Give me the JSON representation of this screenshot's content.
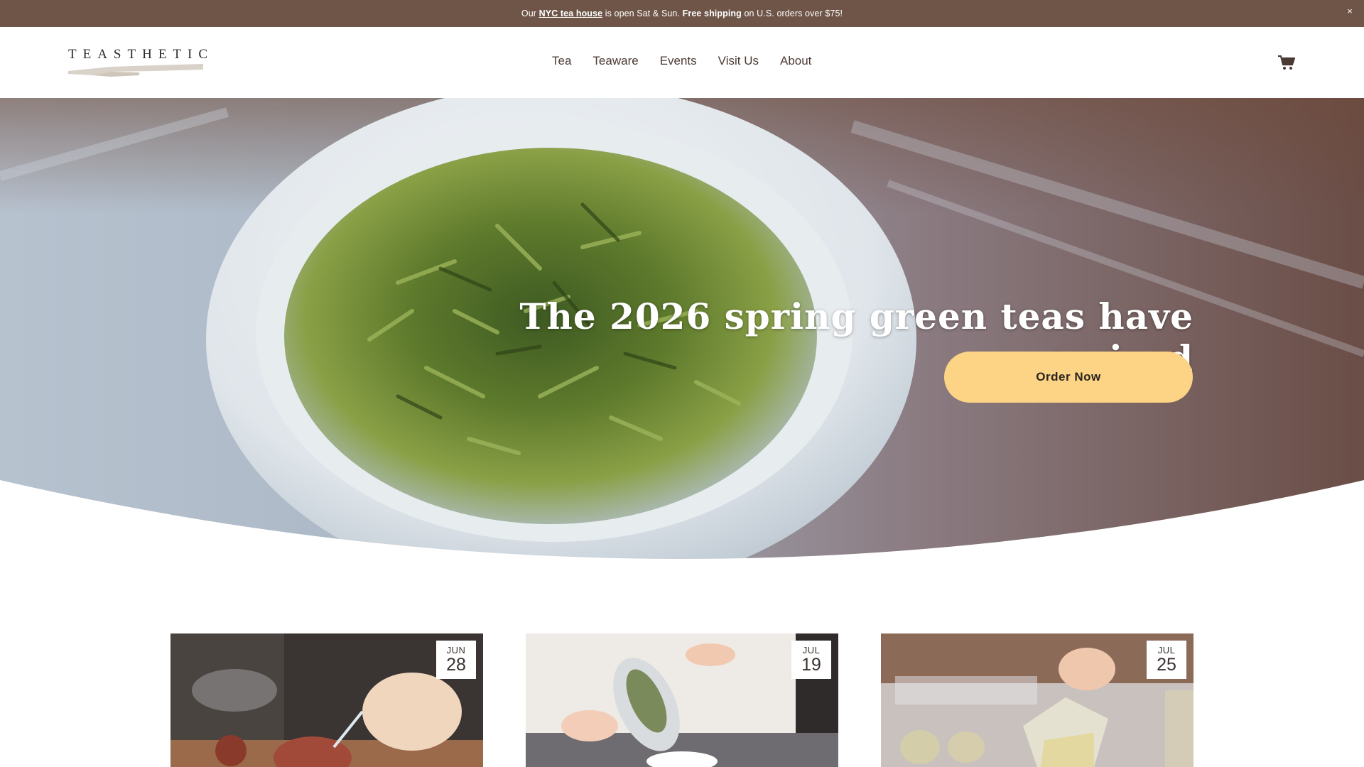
{
  "announcement": {
    "prefix": "Our",
    "link_text": "NYC tea house",
    "middle": "is open Sat & Sun.",
    "bold": "Free shipping",
    "suffix": "on U.S. orders over $75!",
    "close": "×"
  },
  "header": {
    "logo_text": "TEASTHETIC",
    "nav": [
      "Tea",
      "Teaware",
      "Events",
      "Visit Us",
      "About"
    ],
    "cart_icon": "cart-icon"
  },
  "hero": {
    "title": "The 2026 spring green teas have arrived",
    "button_label": "Order Now"
  },
  "events": [
    {
      "month": "JUN",
      "day": "28"
    },
    {
      "month": "JUL",
      "day": "19"
    },
    {
      "month": "JUL",
      "day": "25"
    }
  ],
  "colors": {
    "announcement_bg": "#6e5548",
    "button_bg": "#fdd485",
    "nav_text": "#4b3a33"
  }
}
